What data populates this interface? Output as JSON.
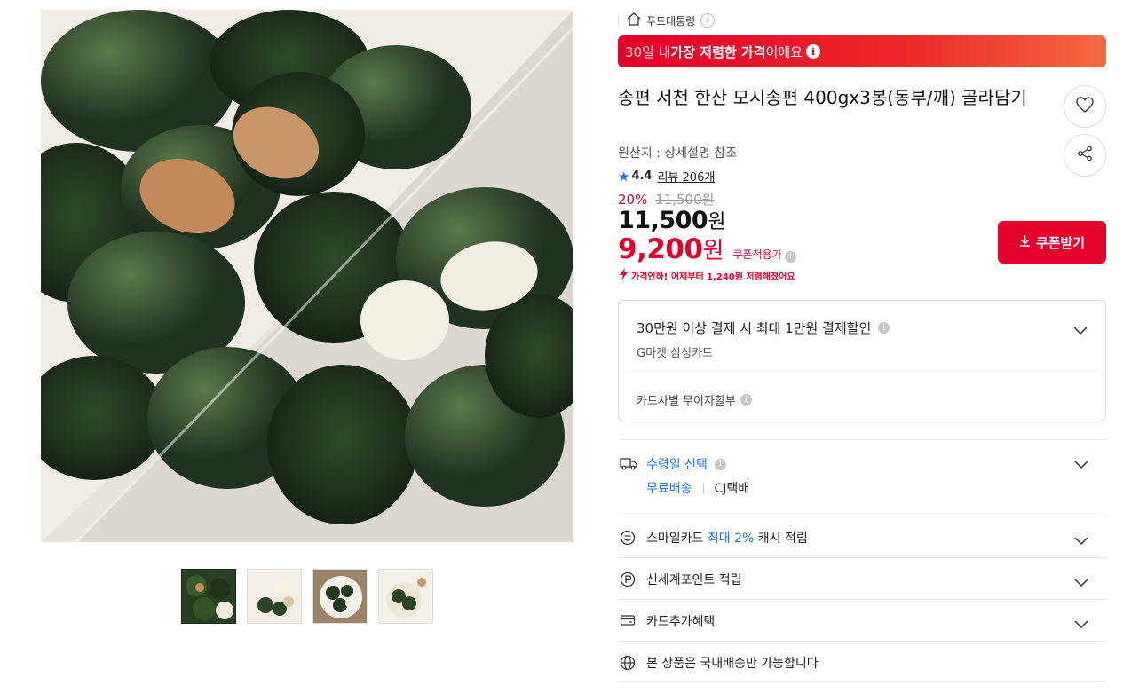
{
  "breadcrumb": {
    "category": "푸드대통령"
  },
  "promo": {
    "prefix": "30일 내 ",
    "highlight": "가장 저렴한 가격",
    "suffix": "이에요"
  },
  "product": {
    "title": "송편 서천 한산 모시송편 400gx3봉(동부/깨) 골라담기",
    "origin": "원산지 : 상세설명 참조",
    "rating": "4.4",
    "review_label": "리뷰 206개",
    "discount_pct": "20%",
    "original_price": "11,500원",
    "price_number": "11,500",
    "price_unit": "원",
    "coupon_price_number": "9,200",
    "coupon_price_unit": "원",
    "coupon_note": "쿠폰적용가",
    "price_drop_note": "가격인하! 어제부터 1,240원 저렴해졌어요",
    "coupon_button": "쿠폰받기"
  },
  "card_benefit": {
    "headline": "30만원 이상 결제 시 최대 1만원 결제할인",
    "card_name": "G마켓 삼성카드",
    "installment": "카드사별 무이자할부"
  },
  "shipping": {
    "label": "수령일 선택",
    "free": "무료배송",
    "carrier": "CJ택배"
  },
  "benefits": {
    "smile_prefix": "스마일카드 ",
    "smile_highlight": "최대 2%",
    "smile_suffix": " 캐시 적립",
    "shinsegae": "신세계포인트 적립",
    "card_extra": "카드추가혜택",
    "domestic": "본 상품은 국내배송만 가능합니다"
  },
  "colors": {
    "accent_red": "#e3002a",
    "link_blue": "#1a73e8"
  },
  "icons": [
    "home-icon",
    "chevron-right-icon",
    "info-icon",
    "heart-icon",
    "share-icon",
    "star-icon",
    "download-icon",
    "truck-icon",
    "smile-icon",
    "point-icon",
    "card-icon",
    "globe-icon",
    "chevron-down-icon"
  ]
}
